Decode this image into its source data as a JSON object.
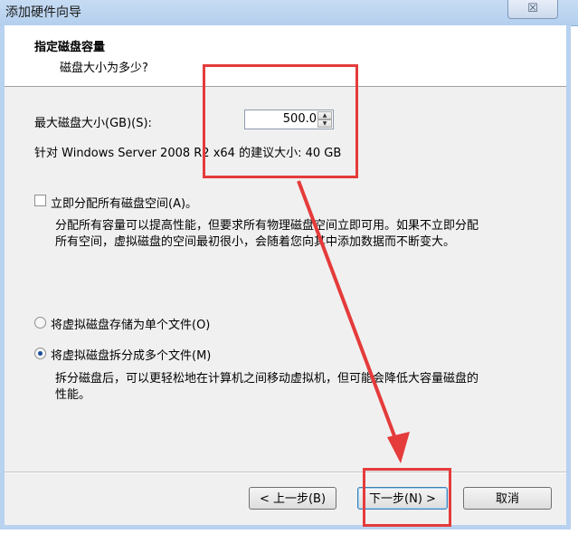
{
  "window": {
    "title": "添加硬件向导",
    "close_glyph": "☒"
  },
  "header": {
    "title": "指定磁盘容量",
    "subtitle": "磁盘大小为多少?"
  },
  "disk_size": {
    "label": "最大磁盘大小(GB)(S):",
    "value": "500.0",
    "up_glyph": "▲",
    "down_glyph": "▼",
    "recommendation": "针对 Windows Server 2008 R2 x64 的建议大小: 40 GB"
  },
  "allocate_now": {
    "label": "立即分配所有磁盘空间(A)。",
    "checked": false,
    "description_line1": "分配所有容量可以提高性能，但要求所有物理磁盘空间立即可用。如果不立即分配",
    "description_line2": "所有空间，虚拟磁盘的空间最初很小，会随着您向其中添加数据而不断变大。"
  },
  "storage": {
    "single_file_label": "将虚拟磁盘存储为单个文件(O)",
    "split_label": "将虚拟磁盘拆分成多个文件(M)",
    "selected": "split",
    "split_description_line1": "拆分磁盘后，可以更轻松地在计算机之间移动虚拟机，但可能会降低大容量磁盘的",
    "split_description_line2": "性能。"
  },
  "buttons": {
    "back": "< 上一步(B)",
    "next": "下一步(N) >",
    "cancel": "取消"
  },
  "annotation": {
    "color": "#e53b3b"
  }
}
